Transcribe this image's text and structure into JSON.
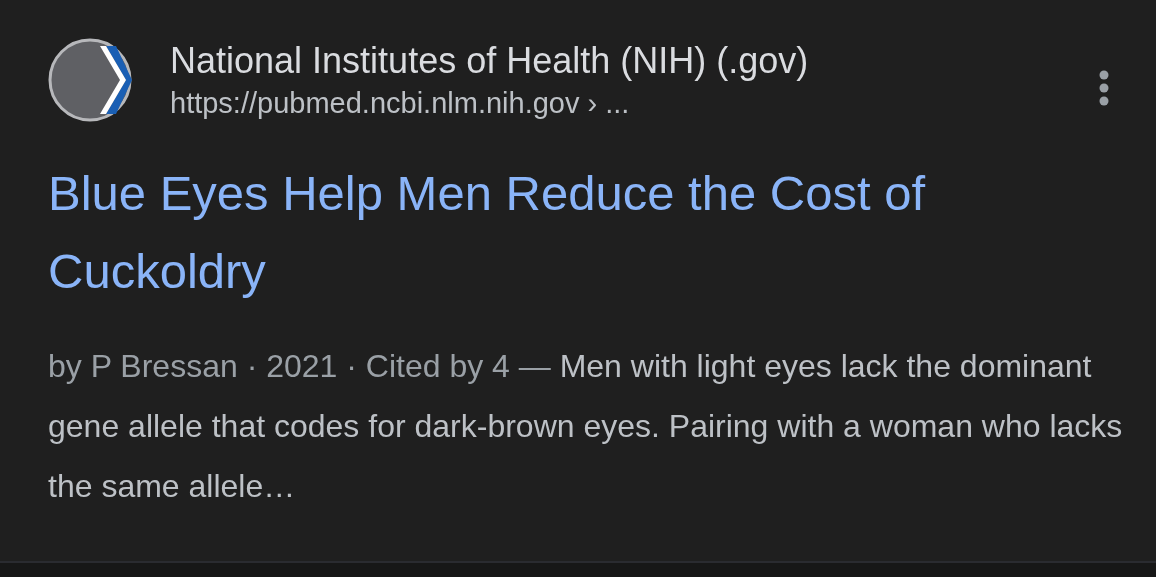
{
  "result": {
    "site_name": "National Institutes of Health (NIH) (.gov)",
    "url": "https://pubmed.ncbi.nlm.nih.gov › ...",
    "title": "Blue Eyes Help Men Reduce the Cost of Cuckoldry",
    "snippet_meta": "by P Bressan · 2021 · Cited by 4 — ",
    "snippet": "Men with light eyes lack the dominant gene allele that codes for dark-brown eyes. Pairing with a woman who lacks the same allele…"
  }
}
